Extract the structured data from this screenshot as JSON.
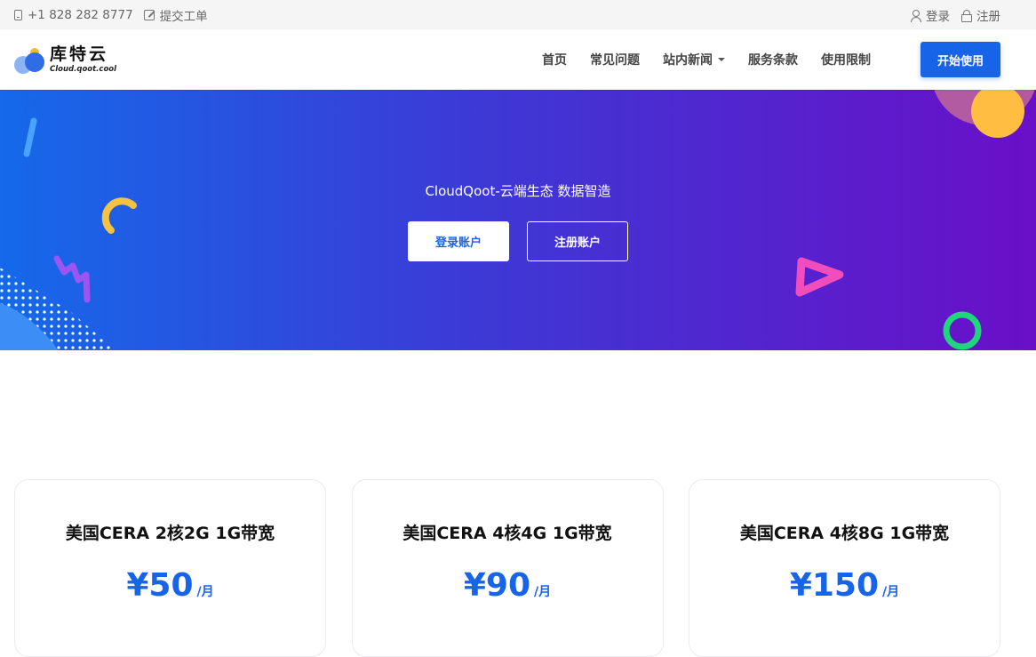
{
  "topbar": {
    "phone": "+1 828 282 8777",
    "ticket": "提交工单",
    "login": "登录",
    "register": "注册"
  },
  "nav": {
    "logo_cn": "库特云",
    "logo_en": "Cloud.qoot.cool",
    "items": [
      {
        "label": "首页"
      },
      {
        "label": "常见问题"
      },
      {
        "label": "站内新闻"
      },
      {
        "label": "服务条款"
      },
      {
        "label": "使用限制"
      }
    ],
    "cta": "开始使用"
  },
  "hero": {
    "tagline": "CloudQoot-云端生态 数据智造",
    "login_button": "登录账户",
    "register_button": "注册账户"
  },
  "plans": [
    {
      "title": "美国CERA 2核2G 1G带宽",
      "price": "¥50",
      "unit": "/月"
    },
    {
      "title": "美国CERA 4核4G 1G带宽",
      "price": "¥90",
      "unit": "/月"
    },
    {
      "title": "美国CERA 4核8G 1G带宽",
      "price": "¥150",
      "unit": "/月"
    }
  ],
  "colors": {
    "accent": "#1764e8",
    "hero_start": "#1569ea",
    "hero_end": "#6a0fc8"
  },
  "icons": [
    "phone-icon",
    "edit-icon",
    "user-icon",
    "lock-icon",
    "caret-down-icon"
  ]
}
